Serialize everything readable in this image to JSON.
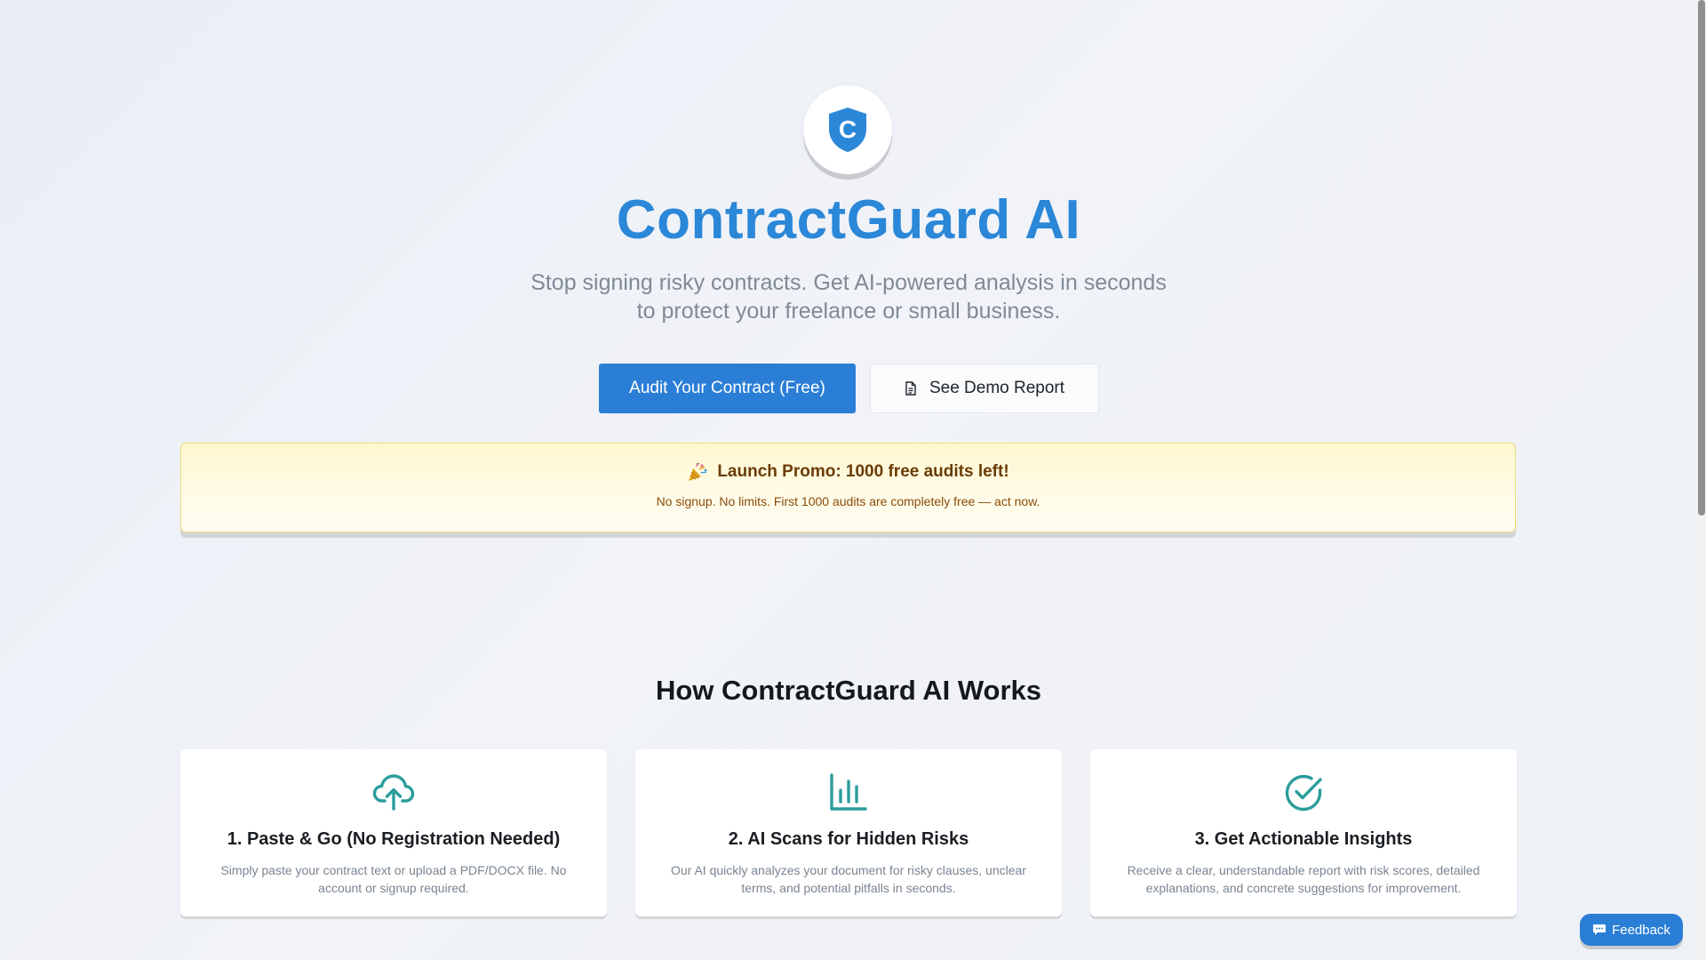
{
  "hero": {
    "logo_letter": "C",
    "title": "ContractGuard AI",
    "subtitle": "Stop signing risky contracts. Get AI-powered analysis in seconds to protect your freelance or small business.",
    "primary_button": "Audit Your Contract (Free)",
    "secondary_button": "See Demo Report",
    "secondary_button_icon": "document-icon"
  },
  "promo": {
    "icon": "party-popper-icon",
    "title": "Launch Promo: 1000 free audits left!",
    "text": "No signup. No limits. First 1000 audits are completely free — act now."
  },
  "how_it_works": {
    "heading": "How ContractGuard AI Works",
    "steps": [
      {
        "icon": "cloud-upload-icon",
        "title": "1. Paste & Go (No Registration Needed)",
        "text": "Simply paste your contract text or upload a PDF/DOCX file. No account or signup required."
      },
      {
        "icon": "bar-chart-icon",
        "title": "2. AI Scans for Hidden Risks",
        "text": "Our AI quickly analyzes your document for risky clauses, unclear terms, and potential pitfalls in seconds."
      },
      {
        "icon": "check-circle-icon",
        "title": "3. Get Actionable Insights",
        "text": "Receive a clear, understandable report with risk scores, detailed explanations, and concrete suggestions for improvement."
      }
    ]
  },
  "feedback": {
    "label": "Feedback",
    "icon": "chat-bubble-icon"
  },
  "colors": {
    "brand_blue": "#2b87d8",
    "button_blue": "#2b7ed6",
    "teal_icon": "#2a9d9b",
    "promo_text": "#6a3c07"
  }
}
